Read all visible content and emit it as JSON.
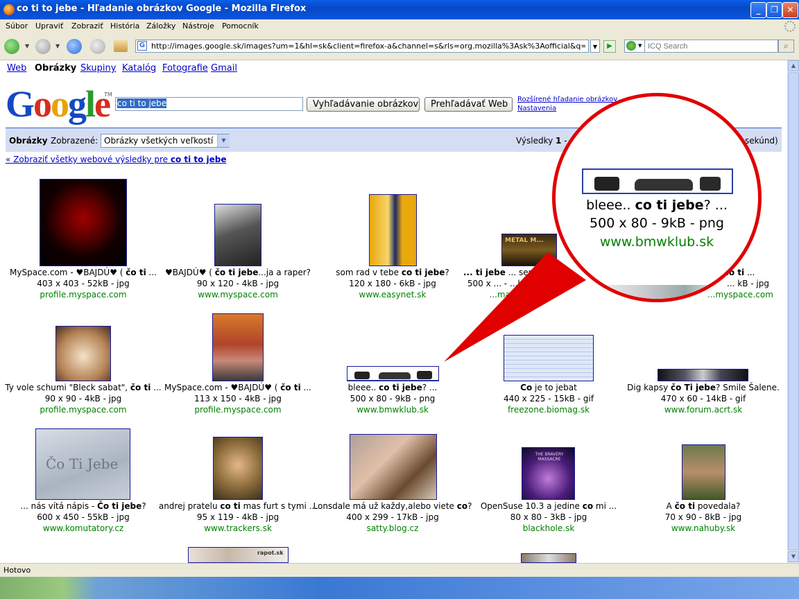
{
  "window": {
    "title": "co ti to jebe - Hľadanie obrázkov Google - Mozilla Firefox",
    "minimize": "_",
    "maximize": "❐",
    "close": "✕"
  },
  "menu": [
    "Súbor",
    "Upraviť",
    "Zobraziť",
    "História",
    "Záložky",
    "Nástroje",
    "Pomocník"
  ],
  "navbar": {
    "url": "http://images.google.sk/images?um=1&hl=sk&client=firefox-a&channel=s&rls=org.mozilla%3Ask%3Aofficial&q=co+ti+to+jebe&",
    "search_placeholder": "ICQ Search"
  },
  "google_nav": {
    "web": "Web",
    "images": "Obrázky",
    "groups": "Skupiny",
    "catalog": "Katalóg",
    "photos": "Fotografie",
    "gmail": "Gmail"
  },
  "search": {
    "logo": "Google",
    "logo_letters": [
      "G",
      "o",
      "o",
      "g",
      "l",
      "e"
    ],
    "tm": "TM",
    "query": "co ti to jebe",
    "btn_images": "Vyhľadávanie obrázkov",
    "btn_web": "Prehľadávať Web",
    "advanced": "Rozšírené hľadanie obrázkov",
    "settings": "Nastavenia"
  },
  "results_bar": {
    "label": "Obrázky",
    "shown_label": "Zobrazené:",
    "size_select": "Obrázky všetkých veľkostí",
    "results_prefix": "Výsledky ",
    "results_from": "1",
    "results_dash": " -",
    "seconds_suffix": "sekúnd)"
  },
  "show_all_web": {
    "prefix": "« Zobraziť všetky webové výsledky pre ",
    "query": "co ti to jebe"
  },
  "results": [
    {
      "title_html": "MySpace.com - ♥BAJDÚ♥ ( <b>čo ti</b> ...",
      "info": "403 x 403 - 52kB - jpg",
      "site": "profile.myspace.com"
    },
    {
      "title_html": "♥BAJDÚ♥ ( <b>čo ti jebe</b>...ja a raper?",
      "info": "90 x 120 - 4kB - jpg",
      "site": "www.myspace.com"
    },
    {
      "title_html": "som rad v tebe <b>co ti jebe</b>?",
      "info": "120 x 180 - 6kB - jpg",
      "site": "www.easynet.sk"
    },
    {
      "title_html": "<b>... ti jebe</b> ... services ...",
      "info": "500 x ... - ...kB - jpg",
      "site": "...mag.sk"
    },
    {
      "title_html": "... ( <b>čo ti</b> ...",
      "info": "... kB - jpg",
      "site": "...myspace.com"
    },
    {
      "title_html": "Ty vole schumi \"Bleck sabat\", <b>čo ti</b> ...",
      "info": "90 x 90 - 4kB - jpg",
      "site": "profile.myspace.com"
    },
    {
      "title_html": "MySpace.com - ♥BAJDÚ♥ ( <b>čo ti</b> ...",
      "info": "113 x 150 - 4kB - jpg",
      "site": "profile.myspace.com"
    },
    {
      "title_html": "bleee.. <b>co ti jebe</b>? ...",
      "info": "500 x 80 - 9kB - png",
      "site": "www.bmwklub.sk"
    },
    {
      "title_html": "<b>Co</b> je to jebat",
      "info": "440 x 225 - 15kB - gif",
      "site": "freezone.biomag.sk"
    },
    {
      "title_html": "Dig kapsy <b>čo Ti jebe</b>? Smile Šalene.",
      "info": "470 x 60 - 14kB - gif",
      "site": "www.forum.acrt.sk"
    },
    {
      "title_html": "... nás vítá nápis - <b>Čo ti jebe</b>?",
      "info": "600 x 450 - 55kB - jpg",
      "site": "www.komutatory.cz"
    },
    {
      "title_html": "andrej pratelu <b>co ti</b> mas furt s tymi ...",
      "info": "95 x 119 - 4kB - jpg",
      "site": "www.trackers.sk"
    },
    {
      "title_html": "Lonsdale má už každy,alebo viete <b>co</b>?",
      "info": "400 x 299 - 17kB - jpg",
      "site": "satty.blog.cz"
    },
    {
      "title_html": "OpenSuse 10.3 a jedine <b>co</b> mi ...",
      "info": "80 x 80 - 3kB - jpg",
      "site": "blackhole.sk"
    },
    {
      "title_html": "A <b>čo ti</b> povedala?",
      "info": "70 x 90 - 8kB - jpg",
      "site": "www.nahuby.sk"
    }
  ],
  "magnifier": {
    "title_html": "bleee.. <b>co ti jebe</b>? ...",
    "info": "500 x 80 - 9kB - png",
    "site": "www.bmwklub.sk"
  },
  "thumb_text": {
    "comment": "",
    "snow": "Čo Ti Jebe",
    "band": "THE BRAVERY MASSACRE",
    "partial": "rapot.sk",
    "metal": "METAL M..."
  },
  "status": "Hotovo",
  "colors": {
    "accent_red": "#e00000",
    "link": "#0000cc",
    "site": "#008000"
  }
}
